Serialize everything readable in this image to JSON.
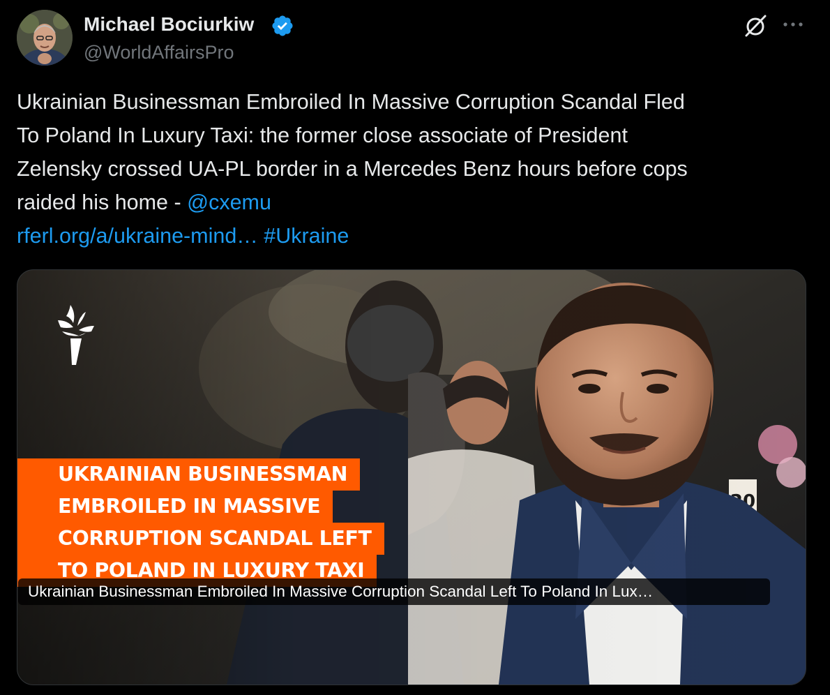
{
  "author": {
    "name": "Michael Bociurkiw",
    "handle": "@WorldAffairsPro",
    "verified": true
  },
  "tweet": {
    "lines": [
      "Ukrainian Businessman Embroiled In Massive Corruption Scandal Fled",
      "To Poland In Luxury Taxi: the former close associate of President",
      "Zelensky crossed UA-PL border in a Mercedes Benz hours before cops"
    ],
    "line4_text": "raided his home - ",
    "mention": "@cxemu",
    "url": "rferl.org/a/ukraine-mind…",
    "hashtag": "#Ukraine"
  },
  "media": {
    "headline_lines": [
      "UKRAINIAN BUSINESSMAN",
      "EMBROILED IN MASSIVE",
      "CORRUPTION SCANDAL LEFT",
      "TO POLAND IN LUXURY TAXI"
    ],
    "caption": "Ukrainian Businessman Embroiled In Massive Corruption Scandal Left To Poland In Lux…",
    "table_number": "20"
  },
  "icons": {
    "verified": "verified-badge-icon",
    "grok": "grok-icon",
    "more": "more-options-icon",
    "logo": "torch-logo-icon"
  },
  "colors": {
    "background": "#000000",
    "text": "#e7e9ea",
    "secondary": "#71767b",
    "link": "#1d9bf0",
    "headline_bg": "#ff5a00"
  }
}
